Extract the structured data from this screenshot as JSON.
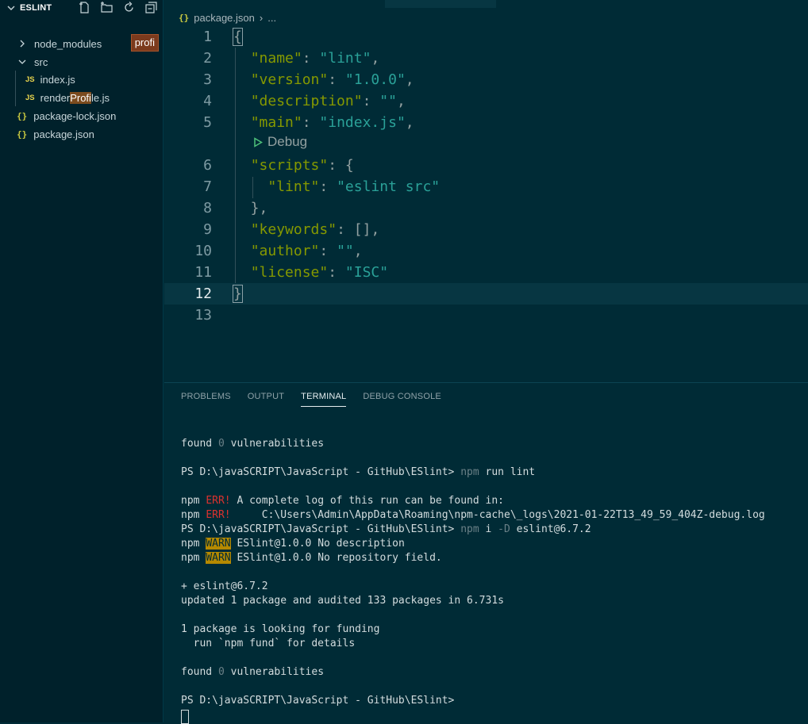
{
  "sidebar": {
    "title": "ESLINT",
    "badge": "profi",
    "items": [
      {
        "label": "node_modules"
      },
      {
        "label": "src"
      },
      {
        "label": "index.js",
        "icon": "JS"
      },
      {
        "label_pre": "render",
        "label_hl": "Profi",
        "label_post": "le.js",
        "icon": "JS"
      },
      {
        "label": "package-lock.json",
        "icon": "{}"
      },
      {
        "label": "package.json",
        "icon": "{}"
      }
    ]
  },
  "editor": {
    "breadcrumb": {
      "icon": "{}",
      "file": "package.json",
      "sep": "›",
      "more": "..."
    },
    "codelens": "Debug",
    "lines": [
      {
        "n": "1"
      },
      {
        "n": "2"
      },
      {
        "n": "3"
      },
      {
        "n": "4"
      },
      {
        "n": "5"
      },
      {
        "n": "6"
      },
      {
        "n": "7"
      },
      {
        "n": "8"
      },
      {
        "n": "9"
      },
      {
        "n": "10"
      },
      {
        "n": "11"
      },
      {
        "n": "12"
      },
      {
        "n": "13"
      }
    ],
    "code": {
      "open": "{",
      "name_k": "\"name\"",
      "name_v": "\"lint\"",
      "version_k": "\"version\"",
      "version_v": "\"1.0.0\"",
      "description_k": "\"description\"",
      "description_v": "\"\"",
      "main_k": "\"main\"",
      "main_v": "\"index.js\"",
      "scripts_k": "\"scripts\"",
      "lint_k": "\"lint\"",
      "lint_v": "\"eslint src\"",
      "keywords_k": "\"keywords\"",
      "keywords_v": "[]",
      "author_k": "\"author\"",
      "author_v": "\"\"",
      "license_k": "\"license\"",
      "license_v": "\"ISC\"",
      "close": "}"
    }
  },
  "panel": {
    "tabs": [
      "PROBLEMS",
      "OUTPUT",
      "TERMINAL",
      "DEBUG CONSOLE"
    ],
    "active_tab": "TERMINAL"
  },
  "terminal": {
    "found_a": "found ",
    "zero": "0",
    "vulns": " vulnerabilities",
    "prompt": "PS D:\\javaSCRIPT\\JavaScript - GitHub\\ESlint> ",
    "cmd1_a": "npm",
    "cmd1_b": " run lint",
    "npm": "npm ",
    "err": "ERR!",
    "err1": " A complete log of this run can be found in:",
    "err2": "     C:\\Users\\Admin\\AppData\\Roaming\\npm-cache\\_logs\\2021-01-22T13_49_59_404Z-debug.log",
    "cmd2_a": "npm",
    "cmd2_b": " i ",
    "cmd2_c": "-D",
    "cmd2_d": " eslint@6.7.2",
    "warn": "WARN",
    "warn1": " ESlint@1.0.0 No description",
    "warn2": " ESlint@1.0.0 No repository field.",
    "plus": "+ eslint@6.7.2",
    "updated": "updated 1 package and audited 133 packages in 6.731s",
    "funding1": "1 package is looking for funding",
    "funding2": "  run `npm fund` for details"
  }
}
